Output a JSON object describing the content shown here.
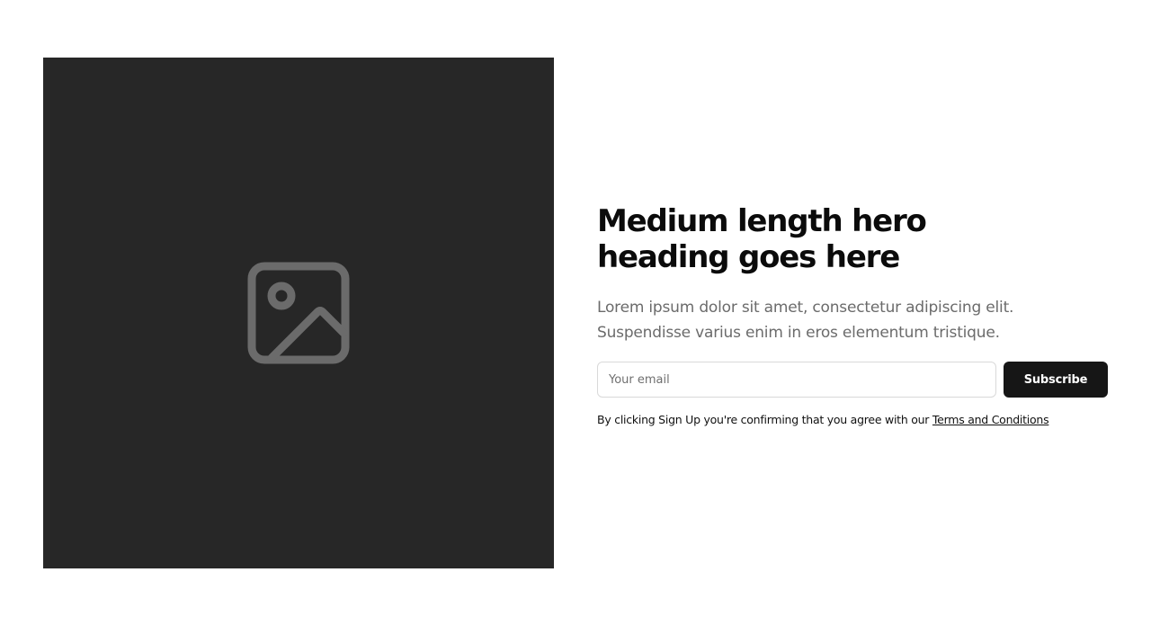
{
  "hero": {
    "image_placeholder_icon": "image-icon",
    "colors": {
      "media_background": "#272727",
      "icon_color": "#6b6b6b",
      "button_background": "#161616",
      "button_text": "#ffffff",
      "heading_color": "#0b0b0b",
      "lede_color": "#6b6b6b"
    },
    "heading": "Medium length hero heading goes here",
    "lede": "Lorem ipsum dolor sit amet, consectetur adipiscing elit. Suspendisse varius enim in eros elementum tristique.",
    "form": {
      "email_placeholder": "Your email",
      "email_value": "",
      "subscribe_label": "Subscribe"
    },
    "disclaimer": {
      "text": "By clicking Sign Up you're confirming that you agree with our ",
      "link_label": "Terms and Conditions"
    }
  }
}
